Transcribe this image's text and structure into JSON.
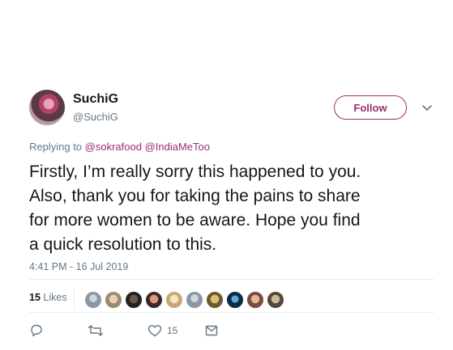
{
  "user": {
    "name": "SuchiG",
    "handle": "@SuchiG"
  },
  "follow_label": "Follow",
  "reply": {
    "prefix": "Replying to",
    "mentions": [
      "@sokrafood",
      "@IndiaMeToo"
    ]
  },
  "tweet_lines": [
    "Firstly, I’m really sorry this happened to you.",
    "Also, thank you for taking the pains to share",
    "for more women to be aware. Hope you find",
    "a quick resolution to this."
  ],
  "timestamp": "4:41 PM - 16 Jul 2019",
  "likes": {
    "count": "15",
    "label": "Likes"
  },
  "actions": {
    "like_count": "15"
  },
  "colors": {
    "accent": "#9b2f6b",
    "muted": "#657786",
    "text": "#14171a",
    "divider": "#e6ecf0"
  },
  "icons": [
    "chevron-down-icon",
    "reply-icon",
    "retweet-icon",
    "heart-icon",
    "message-icon"
  ]
}
